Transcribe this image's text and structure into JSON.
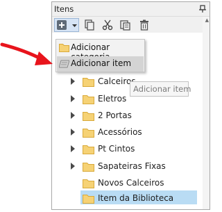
{
  "panel": {
    "title": "Itens"
  },
  "toolbar": {
    "icons": [
      "add-icon",
      "dropdown-arrow-icon",
      "copy-icon",
      "cut-icon",
      "paste-icon",
      "delete-icon"
    ]
  },
  "menu": {
    "items": [
      {
        "label": "Adicionar categoria",
        "icon": "folder-icon"
      },
      {
        "label": "Adicionar item",
        "icon": "item-icon"
      }
    ]
  },
  "tooltip": {
    "text": "Adicionar item"
  },
  "tree": {
    "items": [
      {
        "label": "Calceiros",
        "expandable": true
      },
      {
        "label": "Eletros",
        "expandable": true
      },
      {
        "label": "2 Portas",
        "expandable": true
      },
      {
        "label": "Acessórios",
        "expandable": true
      },
      {
        "label": "Pt Cintos",
        "expandable": true
      },
      {
        "label": "Sapateiras Fixas",
        "expandable": true
      },
      {
        "label": "Novos Calceiros",
        "expandable": false
      },
      {
        "label": "Item da Biblioteca",
        "expandable": false,
        "selected": true
      }
    ]
  },
  "colors": {
    "annotation_arrow": "#e8141c",
    "folder": "#f6d275",
    "selection": "#b9dcf4",
    "menu_hover": "#d4d4d4"
  }
}
